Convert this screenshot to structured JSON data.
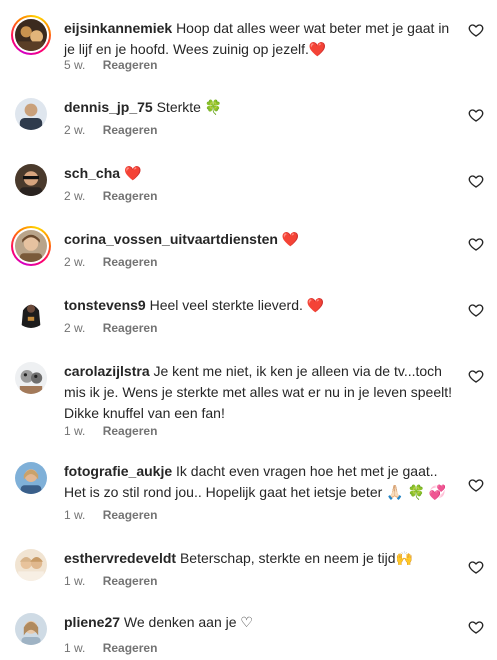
{
  "comments": [
    {
      "user": "eijsinkannemiek",
      "text": "Hoop dat alles weer wat beter met je gaat in je lijf en je hoofd. Wees zuinig op jezelf.",
      "emoji": "❤️",
      "age": "5 w.",
      "reply": "Reageren",
      "story_ring": true,
      "avatar_color": "#3b2a1e"
    },
    {
      "user": "dennis_jp_75",
      "text": "Sterkte",
      "emoji": "🍀",
      "age": "2 w.",
      "reply": "Reageren",
      "story_ring": false,
      "avatar_color": "#2f3b4c"
    },
    {
      "user": "sch_cha",
      "text": "",
      "emoji": "❤️",
      "age": "2 w.",
      "reply": "Reageren",
      "story_ring": false,
      "avatar_color": "#4a3a2c"
    },
    {
      "user": "corina_vossen_uitvaartdiensten",
      "text": "",
      "emoji": "❤️",
      "age": "2 w.",
      "reply": "Reageren",
      "story_ring": true,
      "avatar_color": "#7a5a3a"
    },
    {
      "user": "tonstevens9",
      "text": "Heel veel sterkte lieverd.",
      "emoji": "❤️",
      "age": "2 w.",
      "reply": "Reageren",
      "story_ring": false,
      "avatar_color": "#1c1c1c"
    },
    {
      "user": "carolazijlstra",
      "text": "Je kent me niet, ik ken je alleen via de tv...toch mis ik je. Wens je sterkte met alles wat er nu in je leven speelt! Dikke knuffel van een fan!",
      "emoji": "",
      "age": "1 w.",
      "reply": "Reageren",
      "story_ring": false,
      "avatar_color": "#8a8a8a"
    },
    {
      "user": "fotografie_aukje",
      "text": "Ik dacht even vragen hoe het met je gaat.. Het is zo stil rond jou.. Hopelijk gaat het ietsje beter",
      "emoji": "🙏🏻 🍀 💞",
      "age": "1 w.",
      "reply": "Reageren",
      "story_ring": false,
      "avatar_color": "#c9a26b"
    },
    {
      "user": "esthervredeveldt",
      "text": "Beterschap, sterkte en neem je tijd",
      "emoji": "🙌",
      "age": "1 w.",
      "reply": "Reageren",
      "story_ring": false,
      "avatar_color": "#d8b48a"
    },
    {
      "user": "pliene27",
      "text": "We denken aan je",
      "emoji": "♡",
      "age": "1 w.",
      "reply": "Reageren",
      "story_ring": false,
      "avatar_color": "#9fb3c4"
    }
  ],
  "colors": {
    "text": "#262626",
    "meta": "#737373",
    "heart_emoji": "#ed1c24",
    "story_ring": "#d300c5"
  },
  "icons": {
    "like": "heart-outline-icon"
  }
}
